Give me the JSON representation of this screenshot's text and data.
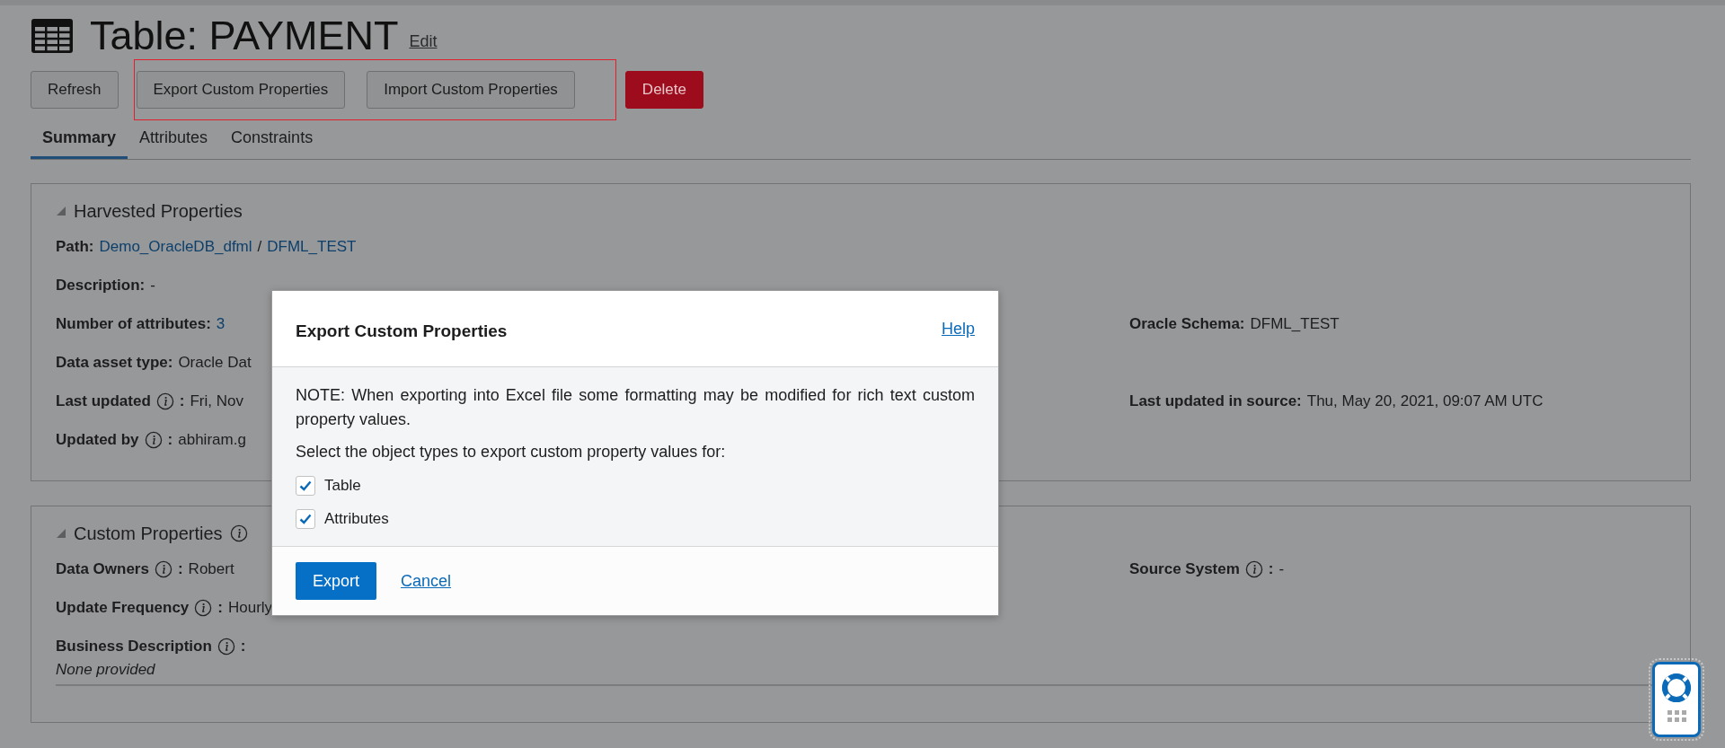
{
  "page": {
    "title": "Table: PAYMENT",
    "edit_link": "Edit"
  },
  "toolbar": [
    {
      "label": "Refresh",
      "kind": "default"
    },
    {
      "label": "Export Custom Properties",
      "kind": "highlighted"
    },
    {
      "label": "Import Custom Properties",
      "kind": "highlighted"
    },
    {
      "label": "Delete",
      "kind": "danger"
    }
  ],
  "tabs": [
    {
      "label": "Summary",
      "selected": true
    },
    {
      "label": "Attributes",
      "selected": false
    },
    {
      "label": "Constraints",
      "selected": false
    }
  ],
  "harvested": {
    "title": "Harvested Properties",
    "rows": [
      {
        "left": {
          "label": "Path:",
          "links": [
            "Demo_OracleDB_dfml",
            "DFML_TEST"
          ],
          "separator": "/"
        }
      },
      {
        "left": {
          "label": "Description:",
          "value": "-"
        }
      },
      {
        "left": {
          "label": "Number of attributes:",
          "value": "3",
          "value_link": true
        },
        "right": {
          "label": "Oracle Schema:",
          "value": "DFML_TEST"
        }
      },
      {
        "left": {
          "label": "Data asset type:",
          "value": "Oracle Dat"
        }
      },
      {
        "left": {
          "label": "Last updated",
          "info": true,
          "suffix": ":",
          "value": "Fri, Nov"
        },
        "right": {
          "label": "Last updated in source:",
          "value": "Thu, May 20, 2021, 09:07 AM UTC"
        }
      },
      {
        "left": {
          "label": "Updated by",
          "info": true,
          "suffix": ":",
          "value": "abhiram.g"
        }
      }
    ]
  },
  "custom": {
    "title": "Custom Properties",
    "info": true,
    "rows": [
      {
        "left": {
          "label": "Data Owners",
          "info": true,
          "suffix": ":",
          "value": "Robert"
        },
        "right": {
          "label": "Source System",
          "info": true,
          "suffix": ":",
          "value": "-"
        }
      },
      {
        "left": {
          "label": "Update Frequency",
          "info": true,
          "suffix": ":",
          "value": "Hourly"
        }
      },
      {
        "left": {
          "label": "Business Description",
          "info": true,
          "suffix": ":",
          "note": "None provided"
        }
      }
    ]
  },
  "dialog": {
    "title": "Export Custom Properties",
    "help_link": "Help",
    "note": "NOTE: When exporting into Excel file some formatting may be modified for rich text custom property values.",
    "prompt": "Select the object types to export custom property values for:",
    "options": [
      {
        "label": "Table",
        "checked": true
      },
      {
        "label": "Attributes",
        "checked": true
      }
    ],
    "primary_button": "Export",
    "cancel_link": "Cancel"
  }
}
